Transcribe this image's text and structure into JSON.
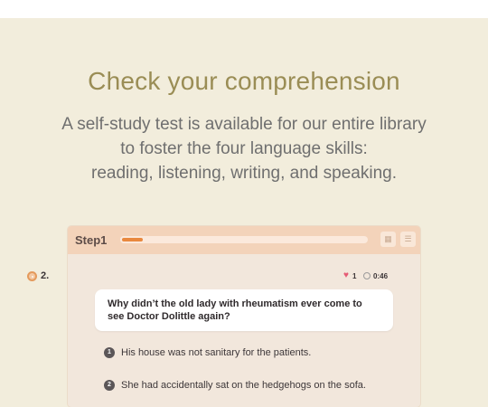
{
  "hero": {
    "title": "Check your comprehension",
    "subtitle_lines": [
      "A self-study test is available for our entire library",
      "to foster the four language skills:",
      "reading, listening, writing, and speaking."
    ]
  },
  "quiz": {
    "step_label": "Step1",
    "progress": 0.1,
    "header_icons": [
      "grid-icon",
      "list-icon"
    ],
    "question_number": "2.",
    "lives": "1",
    "timer": "0:46",
    "question": "Why didn’t the old lady with rheumatism ever come to see Doctor Dolittle again?",
    "answers": [
      {
        "num": "1",
        "text": "His house was not sanitary for the patients."
      },
      {
        "num": "2",
        "text": "She had accidentally sat on the hedgehogs on the sofa."
      }
    ]
  },
  "colors": {
    "background": "#f2eddc",
    "title": "#9a8d55",
    "accent": "#e9883e",
    "header": "#f3d3ba"
  }
}
